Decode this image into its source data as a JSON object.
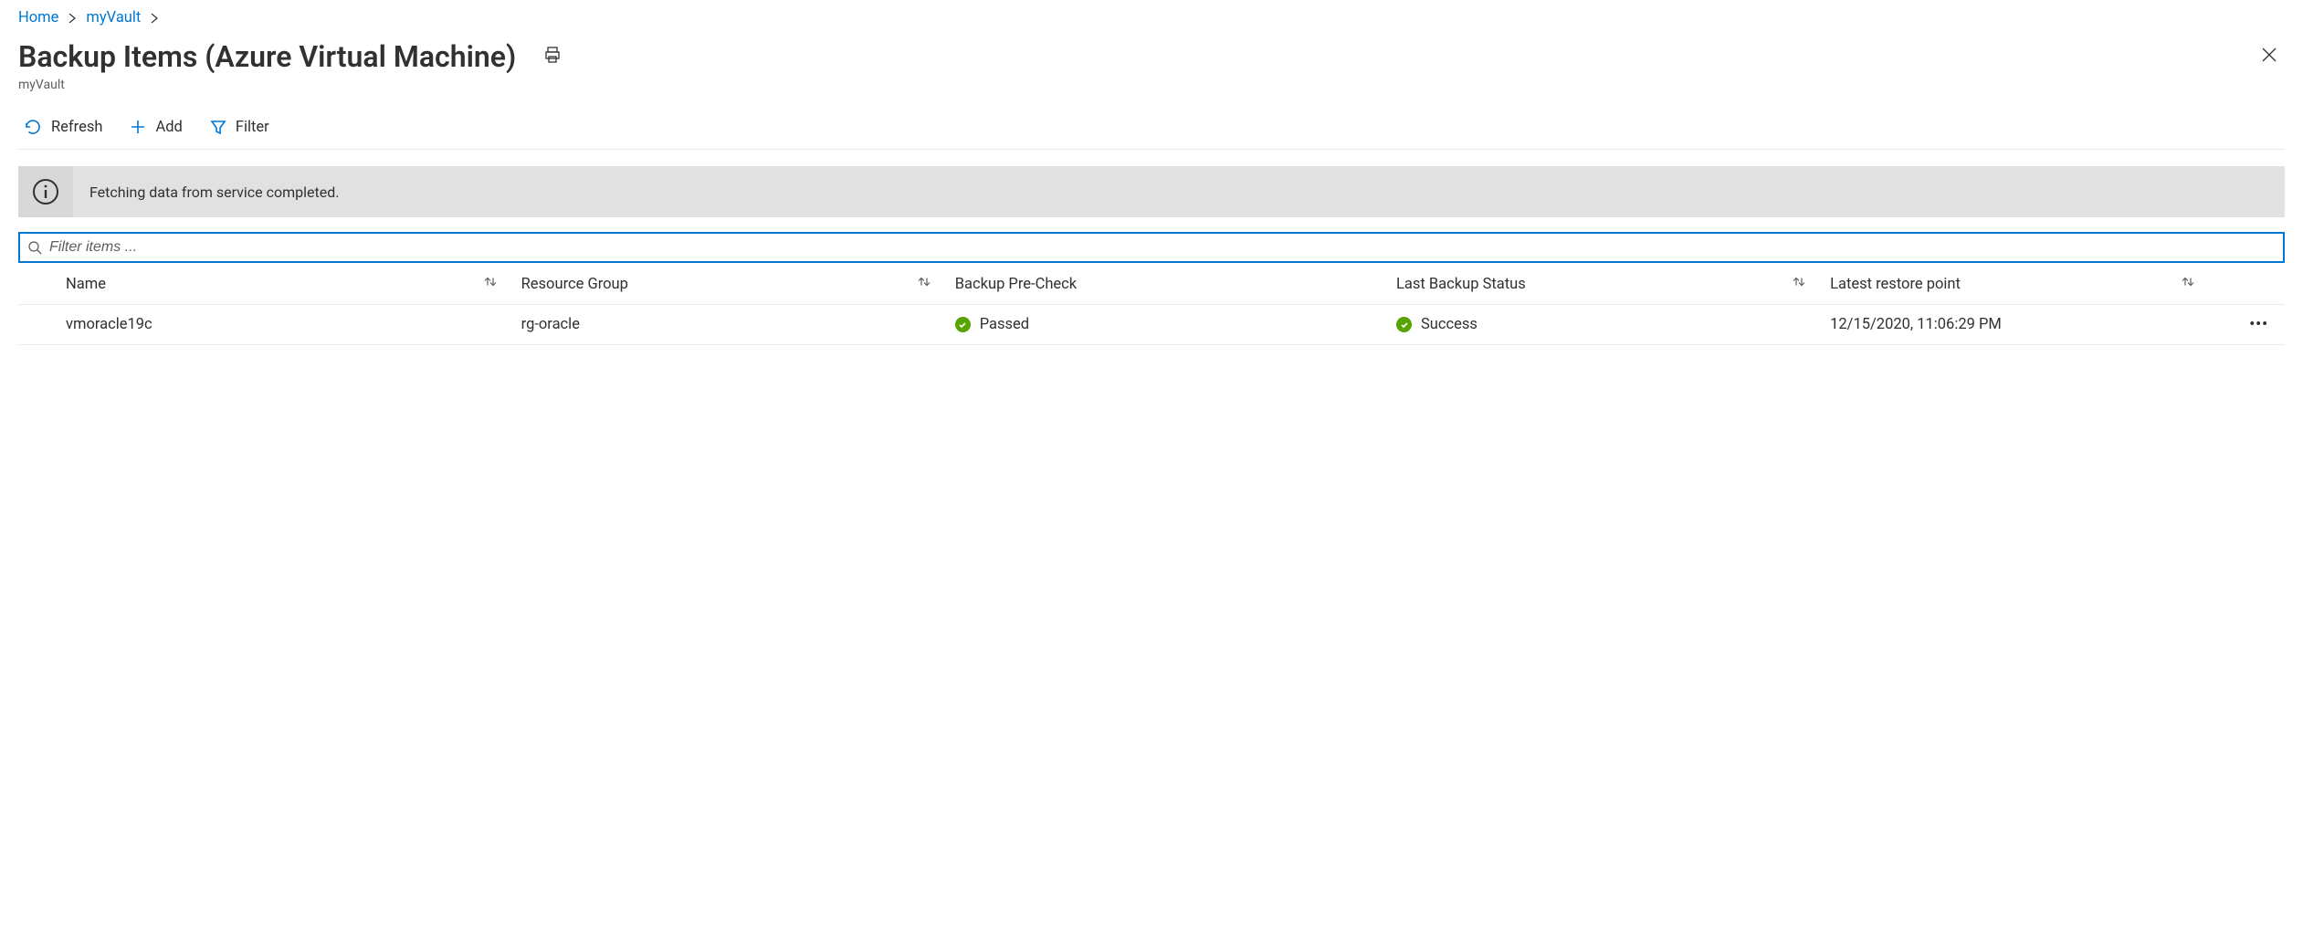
{
  "breadcrumb": {
    "items": [
      {
        "label": "Home"
      },
      {
        "label": "myVault"
      }
    ]
  },
  "header": {
    "title": "Backup Items (Azure Virtual Machine)",
    "subtitle": "myVault"
  },
  "toolbar": {
    "refresh_label": "Refresh",
    "add_label": "Add",
    "filter_label": "Filter"
  },
  "banner": {
    "message": "Fetching data from service completed."
  },
  "filter": {
    "placeholder": "Filter items ..."
  },
  "table": {
    "columns": {
      "name": "Name",
      "resource_group": "Resource Group",
      "precheck": "Backup Pre-Check",
      "last_status": "Last Backup Status",
      "restore_point": "Latest restore point"
    },
    "rows": [
      {
        "name": "vmoracle19c",
        "resource_group": "rg-oracle",
        "precheck": "Passed",
        "last_status": "Success",
        "restore_point": "12/15/2020, 11:06:29 PM"
      }
    ]
  },
  "colors": {
    "accent": "#0078d4",
    "success": "#57a300"
  }
}
